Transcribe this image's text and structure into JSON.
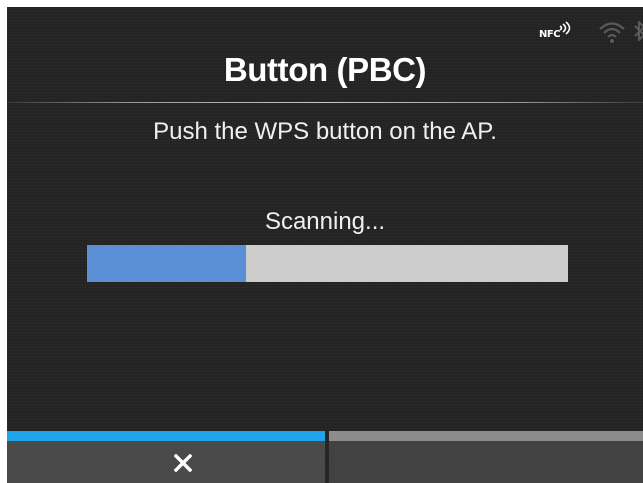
{
  "status_bar": {
    "icons": [
      "nfc-icon",
      "wifi-icon",
      "bluetooth-icon"
    ],
    "nfc_label": "NFC"
  },
  "dialog": {
    "title": "Button (PBC)",
    "message": "Push the WPS button on the AP.",
    "status": "Scanning...",
    "progress_fraction": 0.33
  },
  "softkeys": {
    "left": {
      "icon": "close-icon",
      "state": "active"
    },
    "right": {
      "icon": "",
      "state": "inactive"
    }
  },
  "colors": {
    "screen_bg": "#232323",
    "progress_fill": "#5a8fd6",
    "progress_track": "#cdcdcd",
    "softkey_active_bar": "#1fa3ea",
    "softkey_inactive_bar": "#8c8c8c"
  }
}
